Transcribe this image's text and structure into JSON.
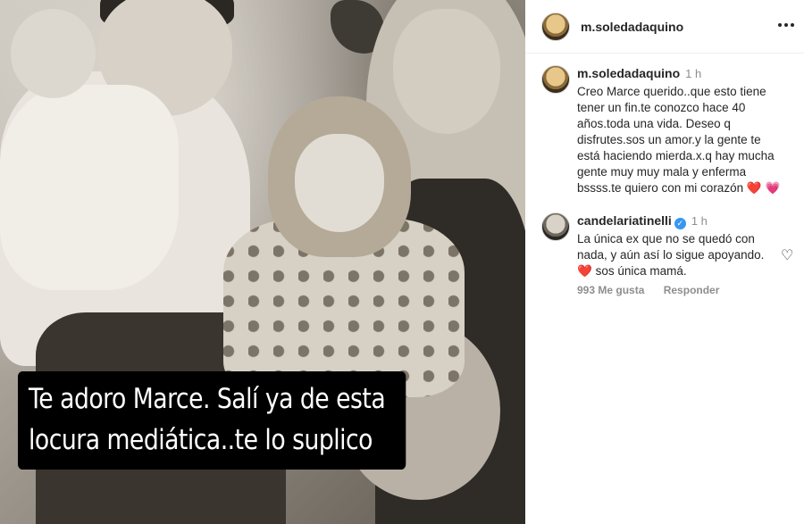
{
  "post": {
    "image_caption_lines": [
      "Te adoro Marce. Salí ya de  esta",
      "locura mediática..te lo suplico"
    ]
  },
  "header": {
    "username": "m.soledadaquino",
    "more_icon": "more-horizontal-icon"
  },
  "comments": [
    {
      "username": "m.soledadaquino",
      "time": "1 h",
      "text": "Creo Marce querido..que esto tiene tener un fin.te conozco hace 40 años.toda una vida.  Deseo q disfrutes.sos un amor.y la gente te está haciendo mierda.x.q hay mucha gente muy muy mala y enferma bssss.te quiero con mi corazón",
      "emojis": [
        "❤️",
        "💗"
      ]
    },
    {
      "username": "candelariatinelli",
      "verified": "✓",
      "time": "1 h",
      "text_line1": "La única ex que no se quedó con nada, y aún así lo sigue apoyando.",
      "emoji": "❤️",
      "text_line2": "sos única mamá.",
      "likes": "993 Me gusta",
      "reply": "Responder",
      "like_icon": "heart-outline-icon"
    }
  ],
  "colors": {
    "text": "#262626",
    "muted": "#8e8e8e",
    "verified": "#3897f0",
    "heart": "#ed2e5a",
    "caption_bg": "#000000"
  }
}
